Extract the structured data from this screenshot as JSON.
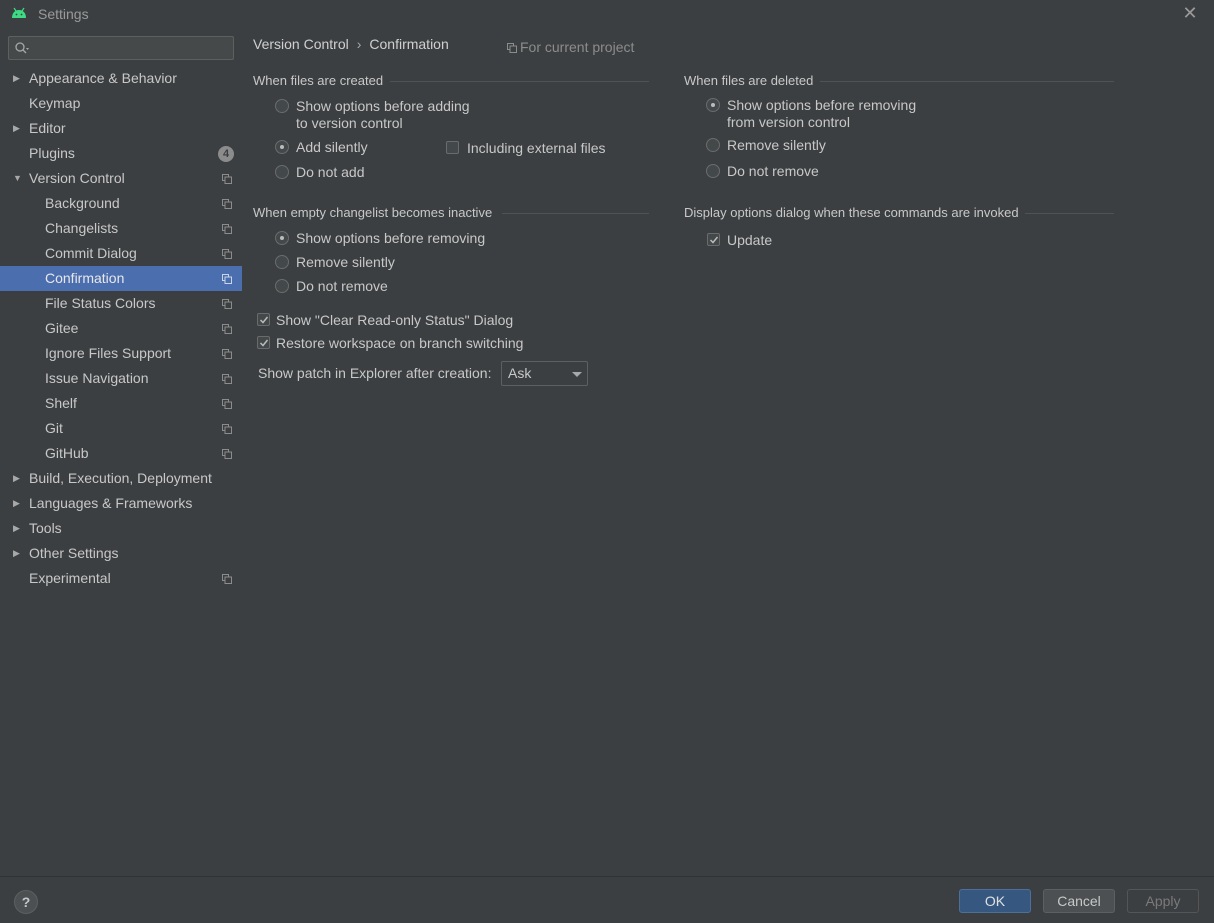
{
  "window": {
    "title": "Settings",
    "close_glyph": "✕",
    "app_icon": "android-icon",
    "accent_color": "#4b6eaf",
    "android_color": "#3ddc84"
  },
  "sidebar": {
    "search_placeholder": "",
    "items": [
      {
        "label": "Appearance & Behavior",
        "arrow": "▶"
      },
      {
        "label": "Keymap"
      },
      {
        "label": "Editor",
        "arrow": "▶"
      },
      {
        "label": "Plugins",
        "badge": "4"
      },
      {
        "label": "Version Control",
        "arrow": "▼"
      },
      {
        "label": "Background"
      },
      {
        "label": "Changelists"
      },
      {
        "label": "Commit Dialog"
      },
      {
        "label": "Confirmation",
        "selected": true
      },
      {
        "label": "File Status Colors"
      },
      {
        "label": "Gitee"
      },
      {
        "label": "Ignore Files Support"
      },
      {
        "label": "Issue Navigation"
      },
      {
        "label": "Shelf"
      },
      {
        "label": "Git"
      },
      {
        "label": "GitHub"
      },
      {
        "label": "Build, Execution, Deployment",
        "arrow": "▶"
      },
      {
        "label": "Languages & Frameworks",
        "arrow": "▶"
      },
      {
        "label": "Tools",
        "arrow": "▶"
      },
      {
        "label": "Other Settings",
        "arrow": "▶"
      },
      {
        "label": "Experimental"
      }
    ]
  },
  "breadcrumb": {
    "parent": "Version Control",
    "separator": "›",
    "current": "Confirmation",
    "scope": "For current project"
  },
  "created": {
    "title": "When files are created",
    "option_show_line1": "Show options before adding",
    "option_show_line2": "to version control",
    "option_silent": "Add silently",
    "option_none": "Do not add",
    "including_external": "Including external files",
    "selected": "Add silently",
    "including_external_checked": false
  },
  "deleted": {
    "title": "When files are deleted",
    "option_show_line1": "Show options before removing",
    "option_show_line2": "from version control",
    "option_silent": "Remove silently",
    "option_none": "Do not remove",
    "selected": "Show options before removing from version control"
  },
  "changelist": {
    "title": "When empty changelist becomes inactive",
    "option_show": "Show options before removing",
    "option_silent": "Remove silently",
    "option_none": "Do not remove",
    "selected": "Show options before removing"
  },
  "display_options": {
    "title": "Display options dialog when these commands are invoked",
    "update_label": "Update",
    "update_checked": true
  },
  "misc": {
    "clear_readonly_label": "Show \"Clear Read-only Status\" Dialog",
    "clear_readonly_checked": true,
    "restore_workspace_label": "Restore workspace on branch switching",
    "restore_workspace_checked": true,
    "show_patch_label": "Show patch in Explorer after creation:",
    "show_patch_value": "Ask"
  },
  "footer": {
    "help": "?",
    "ok": "OK",
    "cancel": "Cancel",
    "apply": "Apply"
  }
}
